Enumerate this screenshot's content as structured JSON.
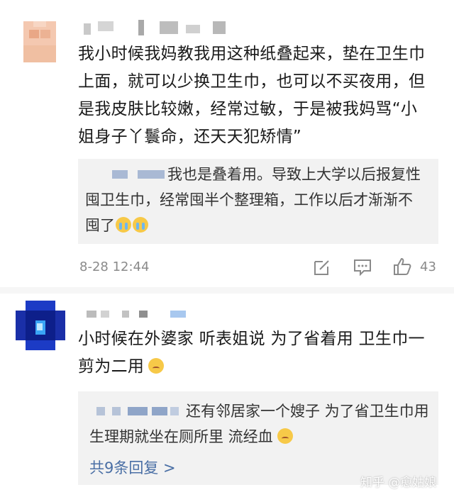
{
  "comments": [
    {
      "text": "我小时候我妈教我用这种纸叠起来，垫在卫生巾上面，就可以少换卫生巾，也可以不买夜用，但是我皮肤比较嫩，经常过敏，于是被我妈骂“小姐身子丫鬟命，还天天犯矫情”",
      "reply": {
        "text": "我也是叠着用。导致上大学以后报复性囤卫生巾，经常囤半个整理箱，工作以后才渐渐不囤了"
      },
      "timestamp": "8-28 12:44",
      "like_count": "43"
    },
    {
      "text": "小时候在外婆家 听表姐说 为了省着用 卫生巾一剪为二用",
      "reply": {
        "text": "还有邻居家一个嫂子 为了省卫生巾用 生理期就坐在厕所里 流经血"
      },
      "more_replies": "共9条回复 >"
    }
  ],
  "watermark": "知乎 @愈姑娘",
  "icons": {
    "edit": "edit-icon",
    "comment": "comment-icon",
    "like": "thumbs-up-icon",
    "cry": "crying-emoji-icon",
    "sad": "sad-emoji-icon"
  },
  "colors": {
    "text": "#1a1a1a",
    "meta": "#8a8a8a",
    "reply_bg": "#f2f2f2",
    "link": "#4a6fa5"
  }
}
